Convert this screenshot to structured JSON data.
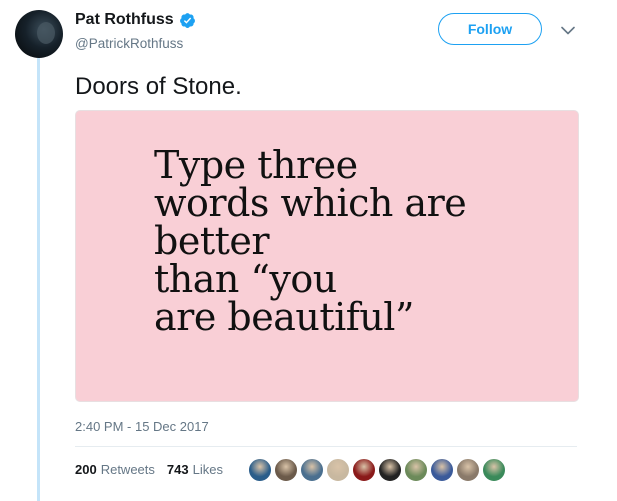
{
  "author": {
    "display_name": "Pat Rothfuss",
    "handle": "@PatrickRothfuss",
    "verified": true
  },
  "header": {
    "follow_label": "Follow",
    "menu_icon": "chevron-down-icon"
  },
  "tweet": {
    "text": "Doors of Stone.",
    "image_text_lines": [
      "Type three",
      "words which are",
      "better",
      "than “you",
      "are beautiful”"
    ],
    "timestamp": "2:40 PM - 15 Dec 2017"
  },
  "stats": {
    "retweets_count": "200",
    "retweets_label": "Retweets",
    "likes_count": "743",
    "likes_label": "Likes"
  },
  "colors": {
    "accent": "#1da1f2",
    "image_background": "#f9cfd6",
    "secondary_text": "#657786",
    "thread_line": "#c4e4f9"
  },
  "likers": [
    {
      "color": "#2a5d8a"
    },
    {
      "color": "#6b5a4a"
    },
    {
      "color": "#4a6f8f"
    },
    {
      "color": "#c8b8a0"
    },
    {
      "color": "#8a1a1a"
    },
    {
      "color": "#222222"
    },
    {
      "color": "#6c8a5a"
    },
    {
      "color": "#3a5a9a"
    },
    {
      "color": "#8a7a6a"
    },
    {
      "color": "#3a8a5a"
    }
  ]
}
